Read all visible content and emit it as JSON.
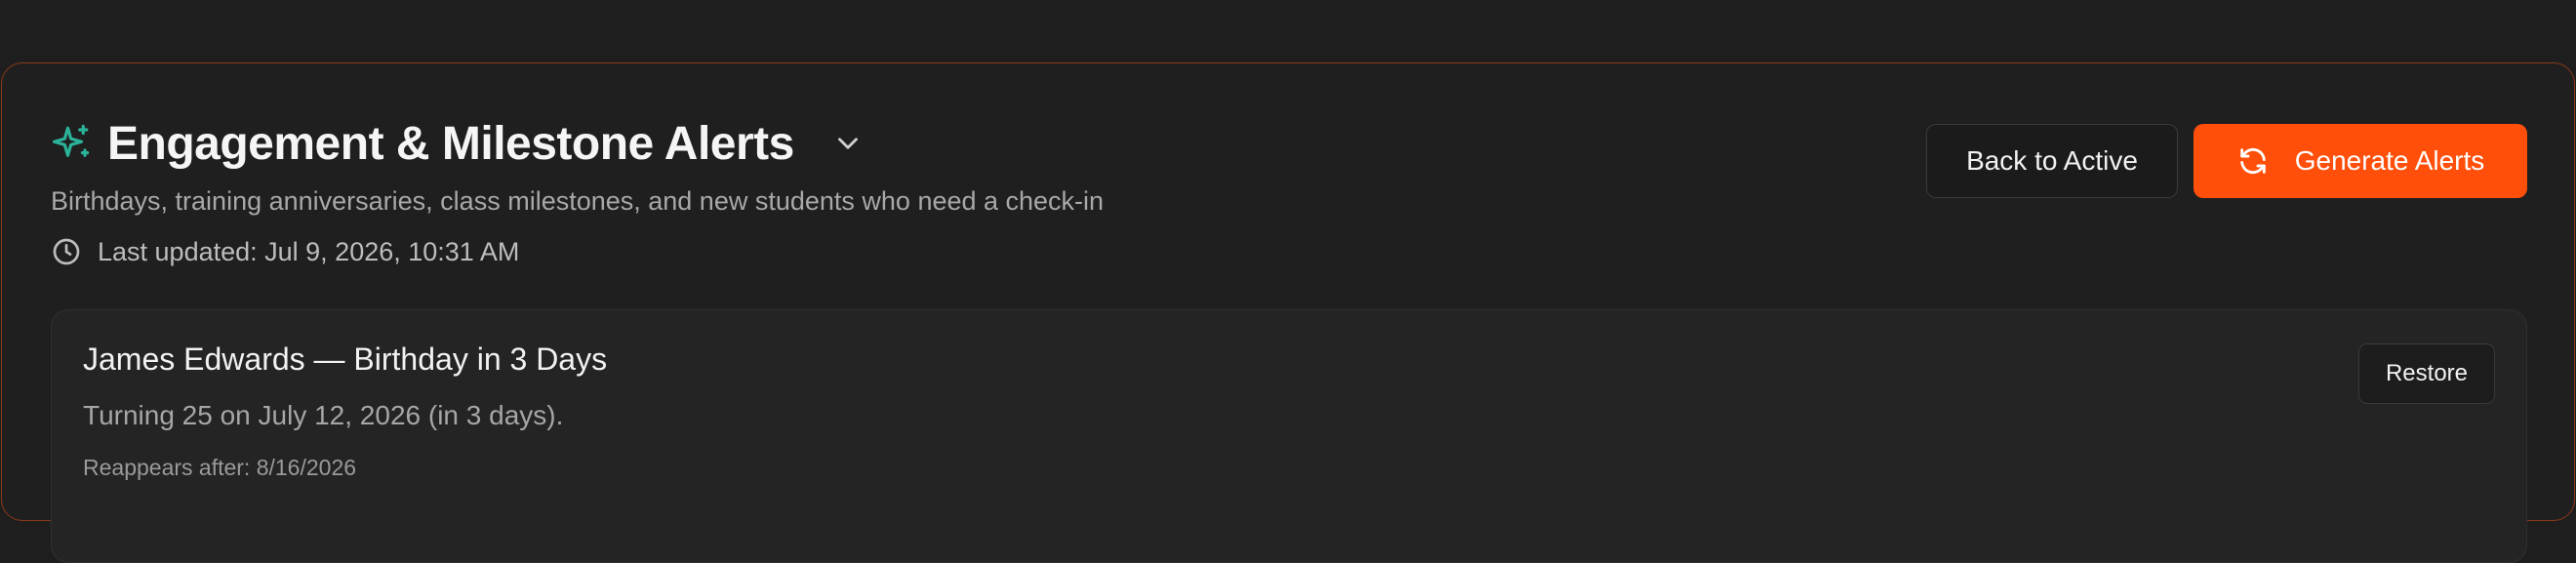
{
  "header": {
    "title": "Engagement & Milestone Alerts",
    "subtitle": "Birthdays, training anniversaries, class milestones, and new students who need a check-in",
    "last_updated": "Last updated: Jul 9, 2026, 10:31 AM",
    "icons": {
      "title": "sparkle-icon",
      "toggle": "chevron-down-icon",
      "updated": "clock-icon"
    }
  },
  "actions": {
    "back_label": "Back to Active",
    "generate_label": "Generate Alerts",
    "generate_icon": "refresh-icon"
  },
  "alerts": [
    {
      "title": "James Edwards — Birthday in 3 Days",
      "description": "Turning 25 on July 12, 2026 (in 3 days).",
      "meta": "Reappears after: 8/16/2026",
      "action_label": "Restore"
    }
  ],
  "colors": {
    "accent": "#ff4f0a",
    "icon_teal": "#2bb39a",
    "background": "#1e1e1e",
    "panel_border": "#8a3a1a"
  }
}
